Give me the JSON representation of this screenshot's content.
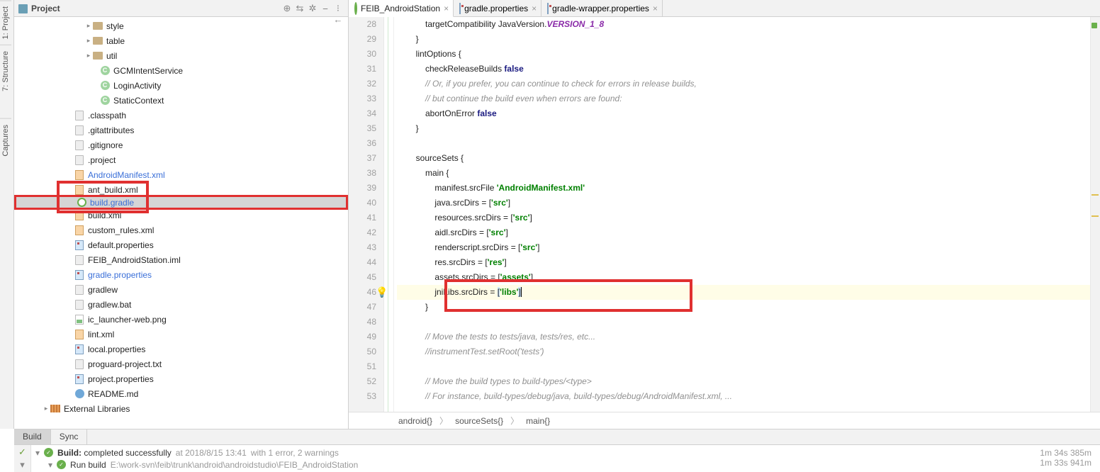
{
  "left_tools": {
    "project": "1: Project",
    "structure": "7: Structure",
    "captures": "Captures"
  },
  "project_header": {
    "title": "Project"
  },
  "tree": {
    "items": [
      {
        "indent": 100,
        "arrow": "▸",
        "icon": "folder",
        "label": "style"
      },
      {
        "indent": 100,
        "arrow": "▸",
        "icon": "folder",
        "label": "table"
      },
      {
        "indent": 100,
        "arrow": "▸",
        "icon": "folder",
        "label": "util"
      },
      {
        "indent": 110,
        "arrow": "",
        "icon": "class",
        "label": "GCMIntentService"
      },
      {
        "indent": 110,
        "arrow": "",
        "icon": "class",
        "label": "LoginActivity"
      },
      {
        "indent": 110,
        "arrow": "",
        "icon": "class",
        "label": "StaticContext"
      },
      {
        "indent": 74,
        "arrow": "",
        "icon": "file",
        "label": ".classpath"
      },
      {
        "indent": 74,
        "arrow": "",
        "icon": "file",
        "label": ".gitattributes"
      },
      {
        "indent": 74,
        "arrow": "",
        "icon": "file",
        "label": ".gitignore"
      },
      {
        "indent": 74,
        "arrow": "",
        "icon": "file",
        "label": ".project"
      },
      {
        "indent": 74,
        "arrow": "",
        "icon": "xml",
        "label": "AndroidManifest.xml",
        "link": true
      },
      {
        "indent": 74,
        "arrow": "",
        "icon": "xml",
        "label": "ant_build.xml",
        "redtop": true
      },
      {
        "indent": 74,
        "arrow": "",
        "icon": "gradle",
        "label": "build.gradle",
        "link": true,
        "sel": true,
        "redbox": true
      },
      {
        "indent": 74,
        "arrow": "",
        "icon": "xml",
        "label": "build.xml",
        "redbot": true
      },
      {
        "indent": 74,
        "arrow": "",
        "icon": "xml",
        "label": "custom_rules.xml"
      },
      {
        "indent": 74,
        "arrow": "",
        "icon": "prop",
        "label": "default.properties"
      },
      {
        "indent": 74,
        "arrow": "",
        "icon": "file",
        "label": "FEIB_AndroidStation.iml"
      },
      {
        "indent": 74,
        "arrow": "",
        "icon": "prop",
        "label": "gradle.properties",
        "link": true
      },
      {
        "indent": 74,
        "arrow": "",
        "icon": "file",
        "label": "gradlew"
      },
      {
        "indent": 74,
        "arrow": "",
        "icon": "file",
        "label": "gradlew.bat"
      },
      {
        "indent": 74,
        "arrow": "",
        "icon": "png",
        "label": "ic_launcher-web.png"
      },
      {
        "indent": 74,
        "arrow": "",
        "icon": "xml",
        "label": "lint.xml"
      },
      {
        "indent": 74,
        "arrow": "",
        "icon": "prop",
        "label": "local.properties"
      },
      {
        "indent": 74,
        "arrow": "",
        "icon": "file",
        "label": "proguard-project.txt"
      },
      {
        "indent": 74,
        "arrow": "",
        "icon": "prop",
        "label": "project.properties"
      },
      {
        "indent": 74,
        "arrow": "",
        "icon": "md",
        "label": "README.md"
      },
      {
        "indent": 40,
        "arrow": "▸",
        "icon": "lib",
        "label": "External Libraries"
      }
    ]
  },
  "tabs": [
    {
      "icon": "gradle",
      "label": "FEIB_AndroidStation",
      "active": true
    },
    {
      "icon": "prop",
      "label": "gradle.properties"
    },
    {
      "icon": "prop",
      "label": "gradle-wrapper.properties"
    }
  ],
  "gutter": {
    "start": 28,
    "end": 53
  },
  "code_lines": [
    {
      "n": 28,
      "html": "            targetCompatibility JavaVersion.<span class='id1'>VERSION_1_8</span>"
    },
    {
      "n": 29,
      "html": "        }"
    },
    {
      "n": 30,
      "html": "        lintOptions {"
    },
    {
      "n": 31,
      "html": "            checkReleaseBuilds <span class='kw'>false</span>"
    },
    {
      "n": 32,
      "html": "            <span class='com'>// Or, if you prefer, you can continue to check for errors in release builds,</span>"
    },
    {
      "n": 33,
      "html": "            <span class='com'>// but continue the build even when errors are found:</span>"
    },
    {
      "n": 34,
      "html": "            abortOnError <span class='kw'>false</span>"
    },
    {
      "n": 35,
      "html": "        }"
    },
    {
      "n": 36,
      "html": ""
    },
    {
      "n": 37,
      "html": "        sourceSets {"
    },
    {
      "n": 38,
      "html": "            main {"
    },
    {
      "n": 39,
      "html": "                manifest.srcFile <span class='str'>'AndroidManifest.xml'</span>"
    },
    {
      "n": 40,
      "html": "                java.srcDirs = [<span class='str'>'src'</span>]"
    },
    {
      "n": 41,
      "html": "                resources.srcDirs = [<span class='str'>'src'</span>]"
    },
    {
      "n": 42,
      "html": "                aidl.srcDirs = [<span class='str'>'src'</span>]"
    },
    {
      "n": 43,
      "html": "                renderscript.srcDirs = [<span class='str'>'src'</span>]"
    },
    {
      "n": 44,
      "html": "                res.srcDirs = [<span class='str'>'res'</span>]"
    },
    {
      "n": 45,
      "html": "                assets.srcDirs = [<span class='str'>'assets'</span>]"
    },
    {
      "n": 46,
      "html": "                jniLibs.srcDirs = <span style='background:#cde8ff'>[</span><span class='str'>'libs'</span><span style='background:#cde8ff' class='caret-br'>]</span>",
      "hl": true,
      "bulb": true
    },
    {
      "n": 47,
      "html": "            }"
    },
    {
      "n": 48,
      "html": ""
    },
    {
      "n": 49,
      "html": "            <span class='com'>// Move the tests to tests/java, tests/res, etc...</span>"
    },
    {
      "n": 50,
      "html": "            <span class='com'>//instrumentTest.setRoot('tests')</span>"
    },
    {
      "n": 51,
      "html": ""
    },
    {
      "n": 52,
      "html": "            <span class='com'>// Move the build types to build-types/&lt;type&gt;</span>"
    },
    {
      "n": 53,
      "html": "            <span class='com'>// For instance, build-types/debug/java, build-types/debug/AndroidManifest.xml, ...</span>"
    }
  ],
  "breadcrumb": [
    "android{}",
    "sourceSets{}",
    "main{}"
  ],
  "bottom_tabs": {
    "build": "Build",
    "sync": "Sync"
  },
  "build": {
    "line1_label": "Build:",
    "line1_status": "completed successfully",
    "line1_time": "at 2018/8/15 13:41",
    "line1_warn": "with 1 error, 2 warnings",
    "line2_label": "Run build",
    "line2_path": "E:\\work-svn\\feib\\trunk\\android\\androidstudio\\FEIB_AndroidStation",
    "time1": "1m 34s 385m",
    "time2": "1m 33s 941m"
  }
}
